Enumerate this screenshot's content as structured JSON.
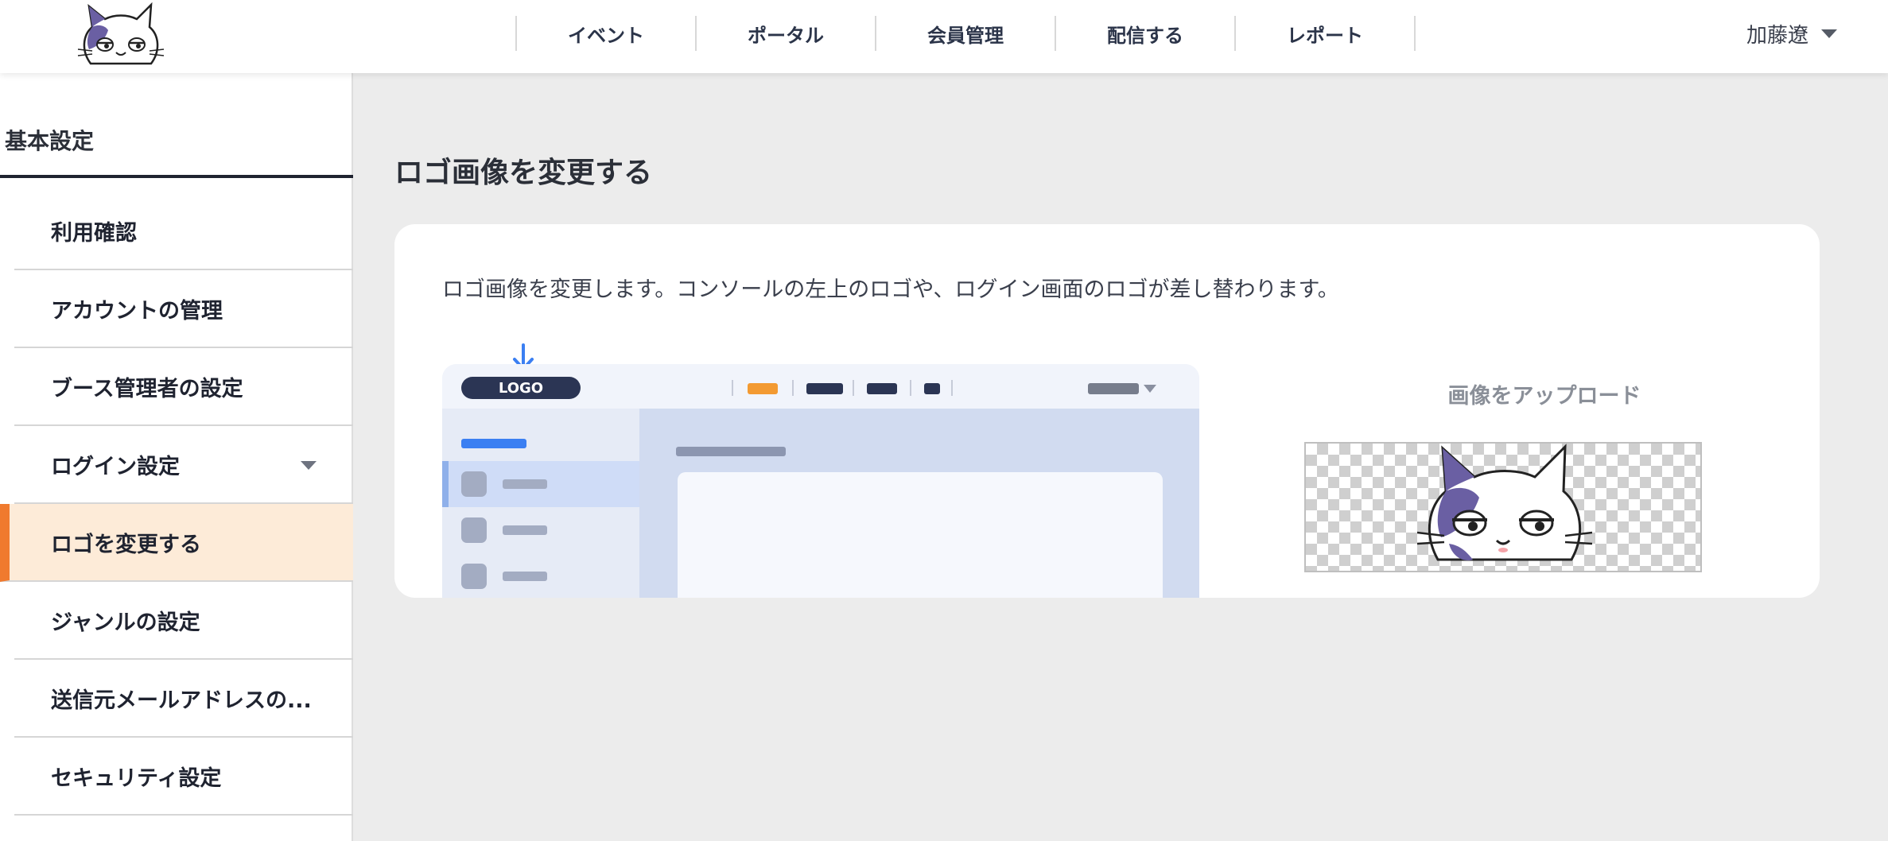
{
  "header": {
    "nav": [
      "イベント",
      "ポータル",
      "会員管理",
      "配信する",
      "レポート"
    ],
    "user_name": "加藤遼"
  },
  "sidebar": {
    "title": "基本設定",
    "items": [
      {
        "label": "利用確認"
      },
      {
        "label": "アカウントの管理"
      },
      {
        "label": "ブース管理者の設定"
      },
      {
        "label": "ログイン設定"
      },
      {
        "label": "ロゴを変更する"
      },
      {
        "label": "ジャンルの設定"
      },
      {
        "label": "送信元メールアドレスの..."
      },
      {
        "label": "セキュリティ設定"
      }
    ],
    "active_index": 4
  },
  "main": {
    "title": "ロゴ画像を変更する",
    "description": "ロゴ画像を変更します。コンソールの左上のロゴや、ログイン画面のロゴが差し替わります。",
    "illustration": {
      "logo_label": "LOGO"
    },
    "upload_label": "画像をアップロード"
  },
  "colors": {
    "accent": "#f07a2e",
    "active_bg": "#fdebd8",
    "page_bg": "#ececec",
    "illustration_blue": "#3b7ff2",
    "illustration_navy": "#2b3554",
    "cat_purple": "#6a5fa3"
  },
  "icons": {
    "brand_logo": "cat-face-logo",
    "user_menu": "chevron-down-icon",
    "login_settings": "chevron-down-icon",
    "illustration_pointer": "arrow-down-icon"
  }
}
